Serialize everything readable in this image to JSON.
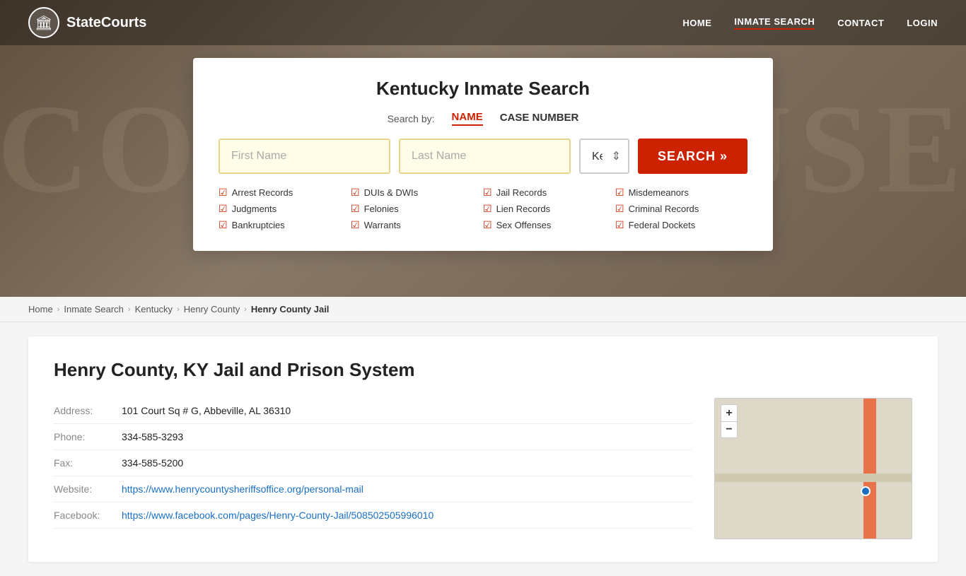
{
  "site": {
    "name": "StateCourts",
    "logo_icon": "🏛"
  },
  "nav": {
    "links": [
      {
        "id": "home",
        "label": "HOME",
        "active": false
      },
      {
        "id": "inmate-search",
        "label": "INMATE SEARCH",
        "active": true
      },
      {
        "id": "contact",
        "label": "CONTACT",
        "active": false
      },
      {
        "id": "login",
        "label": "LOGIN",
        "active": false
      }
    ]
  },
  "hero": {
    "bg_text": "COURTHOUSE"
  },
  "search_card": {
    "title": "Kentucky Inmate Search",
    "search_by_label": "Search by:",
    "tabs": [
      {
        "id": "name",
        "label": "NAME",
        "active": true
      },
      {
        "id": "case-number",
        "label": "CASE NUMBER",
        "active": false
      }
    ],
    "first_name_placeholder": "First Name",
    "last_name_placeholder": "Last Name",
    "state_default": "Kentucky",
    "search_button_label": "SEARCH »",
    "checklist": [
      {
        "col": 1,
        "items": [
          "Arrest Records",
          "Judgments",
          "Bankruptcies"
        ]
      },
      {
        "col": 2,
        "items": [
          "DUIs & DWIs",
          "Felonies",
          "Warrants"
        ]
      },
      {
        "col": 3,
        "items": [
          "Jail Records",
          "Lien Records",
          "Sex Offenses"
        ]
      },
      {
        "col": 4,
        "items": [
          "Misdemeanors",
          "Criminal Records",
          "Federal Dockets"
        ]
      }
    ]
  },
  "breadcrumb": {
    "items": [
      {
        "label": "Home",
        "href": "#"
      },
      {
        "label": "Inmate Search",
        "href": "#"
      },
      {
        "label": "Kentucky",
        "href": "#"
      },
      {
        "label": "Henry County",
        "href": "#"
      },
      {
        "label": "Henry County Jail",
        "current": true
      }
    ]
  },
  "content": {
    "heading": "Henry County, KY Jail and Prison System",
    "address_label": "Address:",
    "address_value": "101 Court Sq # G, Abbeville, AL 36310",
    "phone_label": "Phone:",
    "phone_value": "334-585-3293",
    "fax_label": "Fax:",
    "fax_value": "334-585-5200",
    "website_label": "Website:",
    "website_url": "https://www.henrycountysheriffsoffice.org/personal-mail",
    "website_display": "https://www.henrycountysheriffsoffice.org/personal-mail",
    "facebook_label": "Facebook:",
    "facebook_url": "https://www.facebook.com/pages/Henry-County-Jail/508502505996010",
    "facebook_display": "https://www.facebook.com/pages/Henry-County-Jail/508502505996010"
  },
  "map": {
    "zoom_in": "+",
    "zoom_out": "−"
  }
}
